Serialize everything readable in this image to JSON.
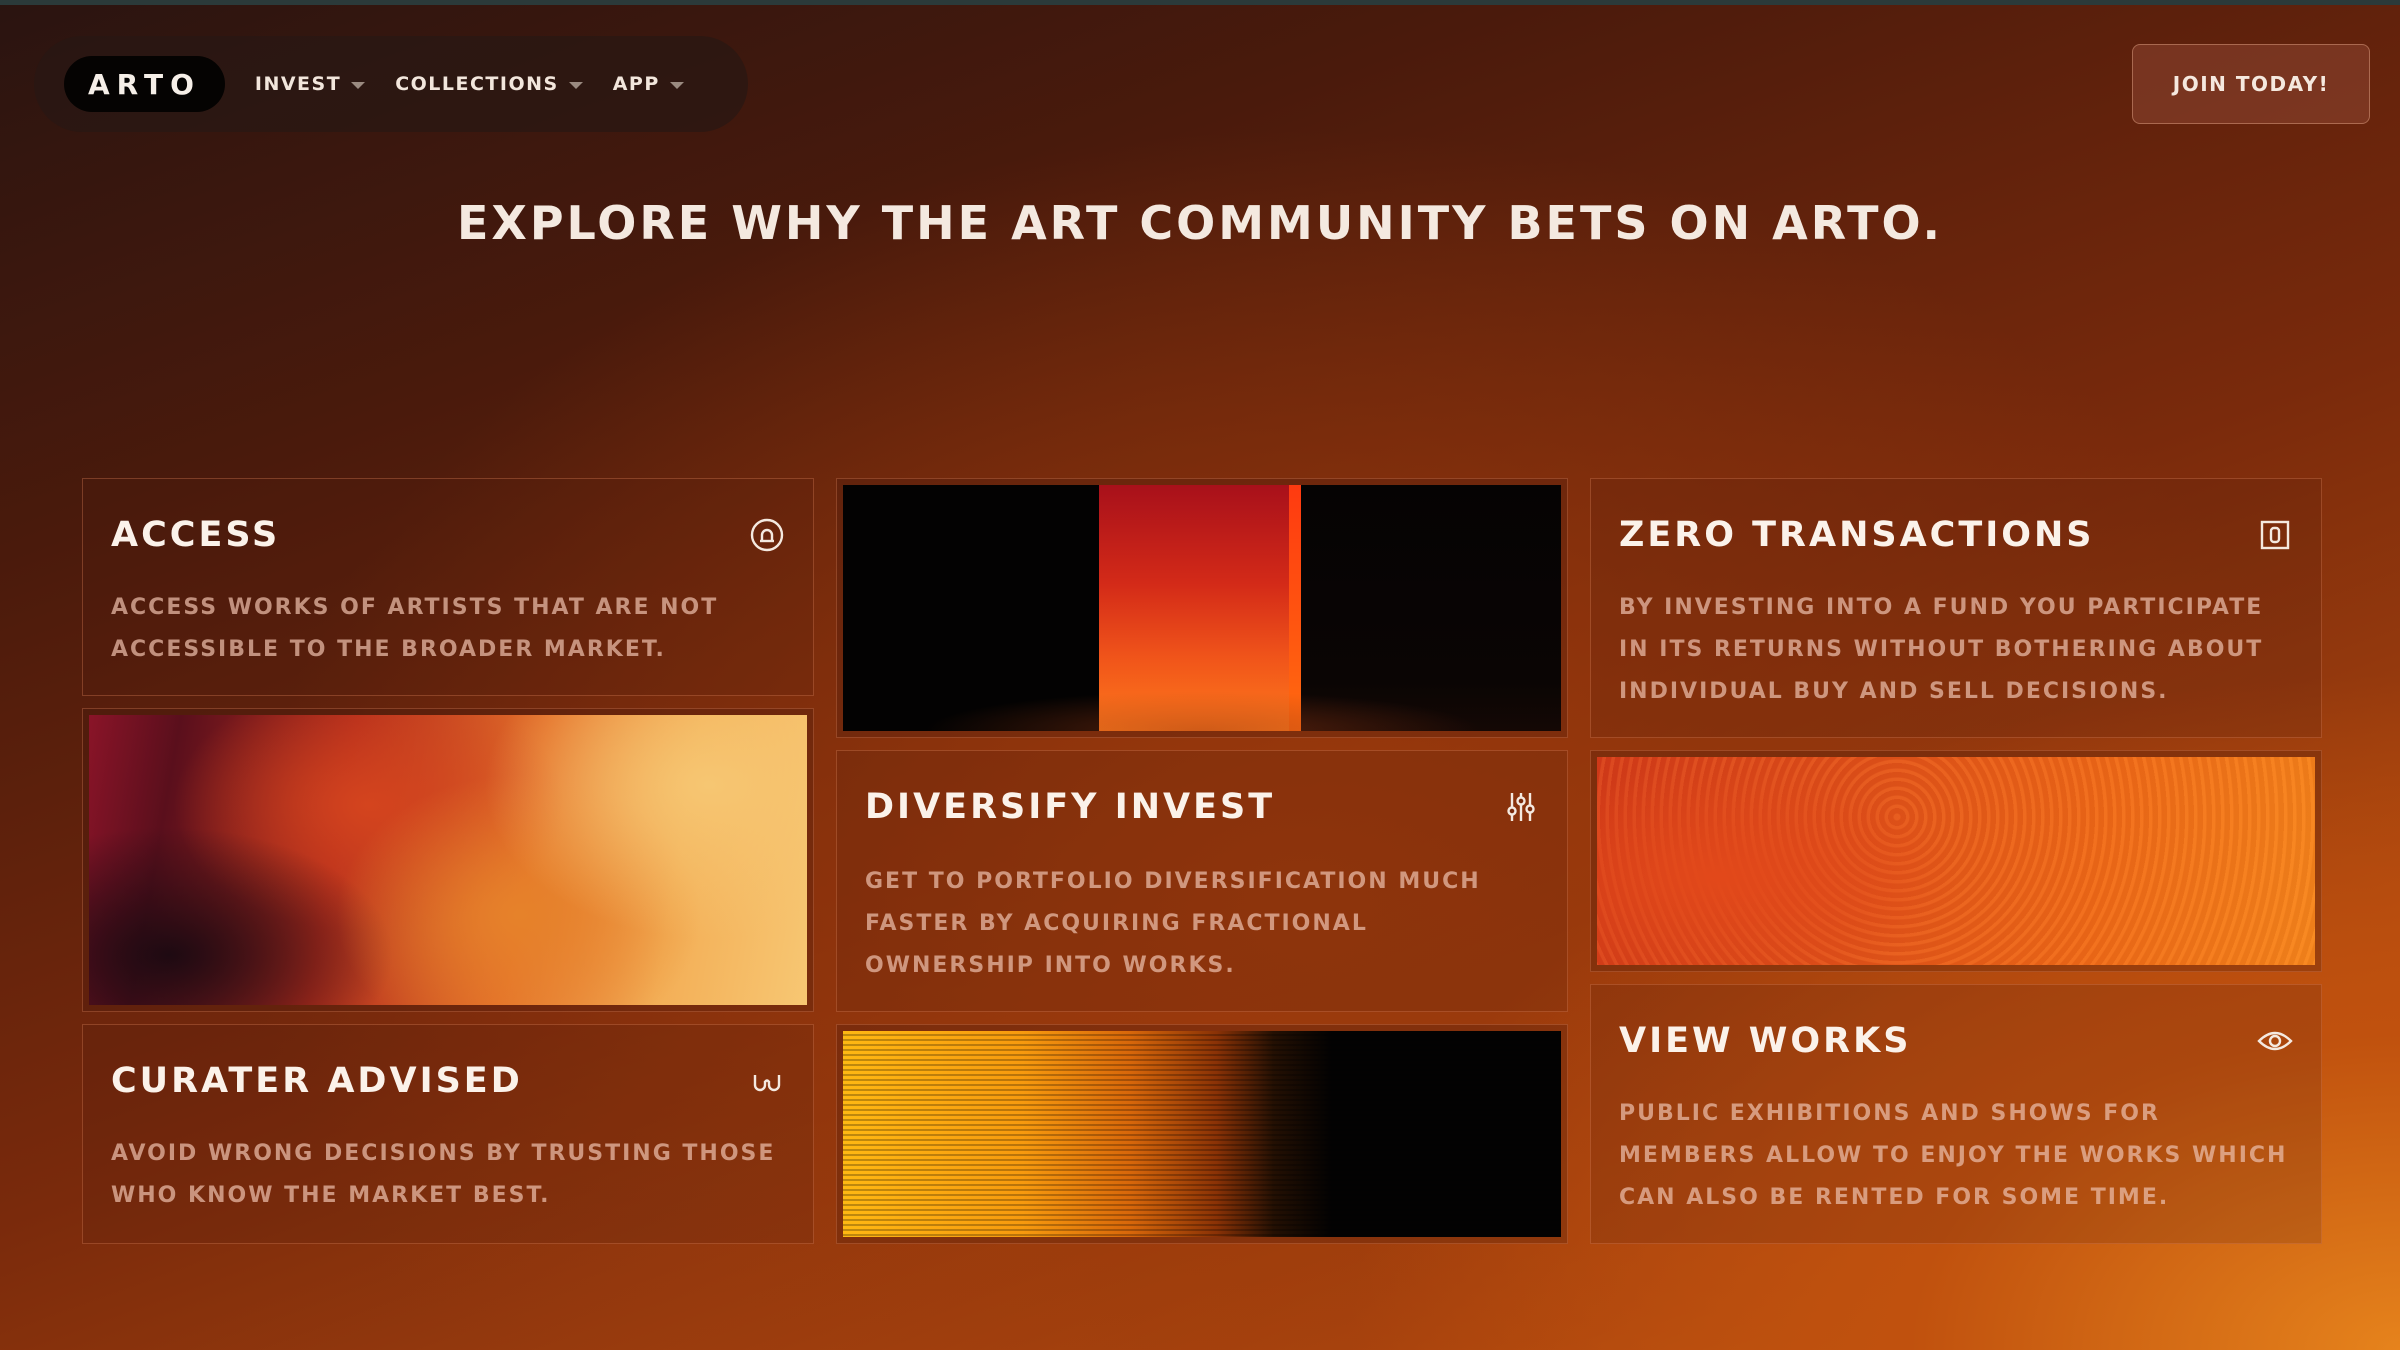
{
  "nav": {
    "logo": "ARTO",
    "items": [
      {
        "label": "INVEST"
      },
      {
        "label": "COLLECTIONS"
      },
      {
        "label": "APP"
      }
    ],
    "cta_label": "JOIN TODAY!"
  },
  "headline": "EXPLORE WHY THE ART COMMUNITY BETS ON ARTO.",
  "cards": {
    "access": {
      "title": "ACCESS",
      "text": "ACCESS WORKS OF ARTISTS THAT ARE NOT ACCESSIBLE TO THE BROADER MARKET.",
      "icon": "lock-circle-icon"
    },
    "zero_transactions": {
      "title": "ZERO TRANSACTIONS",
      "text": "BY INVESTING INTO A FUND YOU PARTICIPATE IN ITS RETURNS WITHOUT BOTHERING ABOUT INDIVIDUAL BUY AND SELL DECISIONS.",
      "icon": "square-box-icon"
    },
    "diversify": {
      "title": "DIVERSIFY INVEST",
      "text": "GET TO PORTFOLIO DIVERSIFICATION MUCH FASTER BY ACQUIRING FRACTIONAL OWNERSHIP INTO WORKS.",
      "icon": "sliders-icon"
    },
    "curater": {
      "title": "CURATER ADVISED",
      "text": "AVOID WRONG DECISIONS BY TRUSTING THOSE WHO KNOW THE MARKET BEST.",
      "icon": "glasses-icon"
    },
    "view_works": {
      "title": "VIEW WORKS",
      "text": "PUBLIC EXHIBITIONS AND SHOWS FOR MEMBERS ALLOW TO ENJOY THE WORKS WHICH CAN ALSO BE RENTED FOR SOME TIME.",
      "icon": "eye-icon"
    }
  },
  "colors": {
    "accent": "#e6831c",
    "background_dark": "#2a1410",
    "text": "#f4e9e0"
  }
}
